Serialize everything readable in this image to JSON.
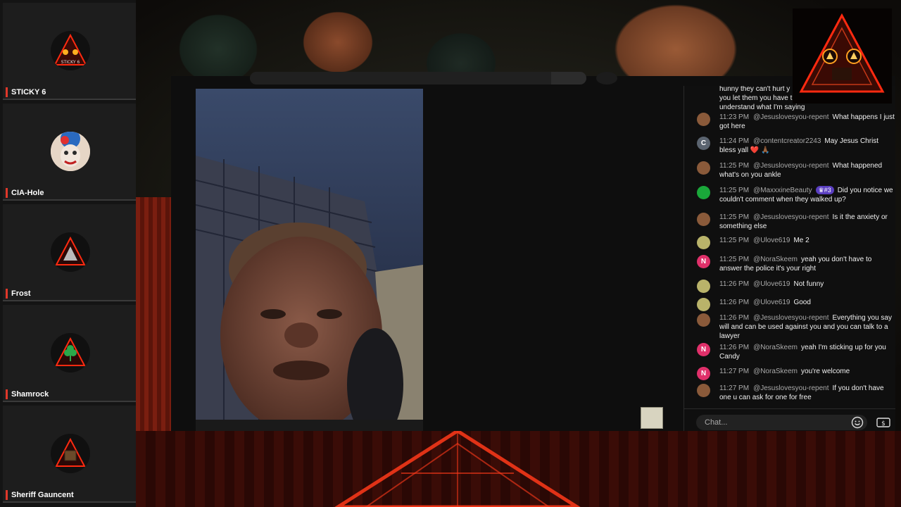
{
  "sidebar": {
    "members": [
      {
        "name": "STICKY 6",
        "avatar_text": "STICKY 6",
        "avatar_icon": "triangle-logo-icon"
      },
      {
        "name": "CIA-Hole",
        "avatar_icon": "clown-face-icon"
      },
      {
        "name": "Frost",
        "avatar_icon": "triangle-logo-icon"
      },
      {
        "name": "Shamrock",
        "avatar_icon": "shamrock-triangle-icon"
      },
      {
        "name": "Sheriff Gauncent",
        "avatar_icon": "box-triangle-icon"
      }
    ]
  },
  "chat": {
    "partial_top": [
      "hunny they can't hurt y",
      "you let them you have t",
      "understand what I'm saying"
    ],
    "messages": [
      {
        "time": "11:23 PM",
        "author": "@Jesuslovesyou-repent",
        "text": "What happens I just got here",
        "avatar": "photo",
        "avatar_color": "#8a5a3a"
      },
      {
        "time": "11:24 PM",
        "author": "@contentcreator2243",
        "text": "May Jesus Christ bless yall ❤️ 🙏🏾",
        "avatar": "C",
        "avatar_color": "#5b6470"
      },
      {
        "time": "11:25 PM",
        "author": "@Jesuslovesyou-repent",
        "text": "What happened what's on you ankle",
        "avatar": "photo",
        "avatar_color": "#8a5a3a"
      },
      {
        "time": "11:25 PM",
        "author": "@MaxxxineBeauty",
        "badge": "♛#3",
        "text": "Did you notice we couldn't comment when they walked up?",
        "avatar": "clover",
        "avatar_color": "#1aa83a"
      },
      {
        "time": "11:25 PM",
        "author": "@Jesuslovesyou-repent",
        "text": "Is it the anxiety or something else",
        "avatar": "photo",
        "avatar_color": "#8a5a3a"
      },
      {
        "time": "11:25 PM",
        "author": "@Ulove619",
        "text": "Me 2",
        "avatar": "photo",
        "avatar_color": "#b9b36a"
      },
      {
        "time": "11:25 PM",
        "author": "@NoraSkeem",
        "text": "yeah you don't have to answer the police it's your right",
        "avatar": "N",
        "avatar_color": "#e0306a"
      },
      {
        "time": "11:26 PM",
        "author": "@Ulove619",
        "text": "Not funny",
        "avatar": "photo",
        "avatar_color": "#b9b36a"
      },
      {
        "time": "11:26 PM",
        "author": "@Ulove619",
        "text": "Good",
        "avatar": "photo",
        "avatar_color": "#b9b36a"
      },
      {
        "time": "11:26 PM",
        "author": "@Jesuslovesyou-repent",
        "text": "Everything you say will and can be used against you and you can talk to a lawyer",
        "avatar": "photo",
        "avatar_color": "#8a5a3a"
      },
      {
        "time": "11:26 PM",
        "author": "@NoraSkeem",
        "text": "yeah I'm sticking up for you Candy",
        "avatar": "N",
        "avatar_color": "#e0306a"
      },
      {
        "time": "11:27 PM",
        "author": "@NoraSkeem",
        "text": "you're welcome",
        "avatar": "N",
        "avatar_color": "#e0306a"
      },
      {
        "time": "11:27 PM",
        "author": "@Jesuslovesyou-repent",
        "text": "If you don't have one u can ask for one for free",
        "avatar": "photo",
        "avatar_color": "#8a5a3a"
      }
    ],
    "input_placeholder": "Chat..."
  },
  "colors": {
    "accent": "#e0382a",
    "neon": "#ff3a1a",
    "badge": "#5a3fc0"
  }
}
